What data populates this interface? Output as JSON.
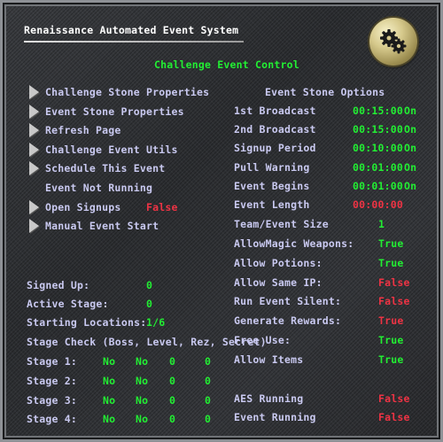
{
  "header": {
    "title": "Renaissance Automated Event System",
    "subtitle": "Challenge Event Control",
    "settings_icon": "gears-icon"
  },
  "menu": [
    {
      "label": "Challenge Stone Properties"
    },
    {
      "label": "Event Stone Properties"
    },
    {
      "label": "Refresh Page"
    },
    {
      "label": "Challenge Event Utils"
    },
    {
      "label": "Schedule This Event"
    }
  ],
  "event_status_text": "Event Not Running",
  "open_signups": {
    "label": "Open Signups",
    "value": "False"
  },
  "manual_start": {
    "label": "Manual Event Start"
  },
  "stats": {
    "signed_up": {
      "label": "Signed Up:",
      "value": "0"
    },
    "active_stage": {
      "label": "Active Stage:",
      "value": "0"
    },
    "starting_locations": {
      "label": "Starting Locations:",
      "value": "1/6"
    }
  },
  "stage_check": {
    "header": "Stage Check (Boss, Level, Rez, Secret)",
    "rows": [
      {
        "label": "Stage 1:",
        "boss": "No",
        "level": "No",
        "rez": "0",
        "secret": "0"
      },
      {
        "label": "Stage 2:",
        "boss": "No",
        "level": "No",
        "rez": "0",
        "secret": "0"
      },
      {
        "label": "Stage 3:",
        "boss": "No",
        "level": "No",
        "rez": "0",
        "secret": "0"
      },
      {
        "label": "Stage 4:",
        "boss": "No",
        "level": "No",
        "rez": "0",
        "secret": "0"
      }
    ]
  },
  "options": {
    "header": "Event Stone Options",
    "items": [
      {
        "label": "1st Broadcast",
        "value": "00:15:00",
        "extra": "On",
        "color": "#22ee33"
      },
      {
        "label": "2nd Broadcast",
        "value": "00:15:00",
        "extra": "On",
        "color": "#22ee33"
      },
      {
        "label": "Signup Period",
        "value": "00:10:00",
        "extra": "On",
        "color": "#22ee33"
      },
      {
        "label": "Pull Warning",
        "value": "00:01:00",
        "extra": "On",
        "color": "#22ee33"
      },
      {
        "label": "Event Begins",
        "value": "00:01:00",
        "extra": "On",
        "color": "#22ee33"
      },
      {
        "label": "Event Length",
        "value": "00:00:00",
        "extra": "",
        "color": "#ee3344"
      },
      {
        "label": "Team/Event Size",
        "value": "1",
        "extra": "",
        "color": "#22ee33"
      },
      {
        "label": "AllowMagic Weapons:",
        "value": "True",
        "extra": "",
        "color": "#22ee33"
      },
      {
        "label": "Allow Potions:",
        "value": "True",
        "extra": "",
        "color": "#22ee33"
      },
      {
        "label": "Allow Same IP:",
        "value": "False",
        "extra": "",
        "color": "#ee3344"
      },
      {
        "label": "Run Event Silent:",
        "value": "False",
        "extra": "",
        "color": "#ee3344"
      },
      {
        "label": "Generate Rewards:",
        "value": "True",
        "extra": "",
        "color": "#ee3344"
      },
      {
        "label": "Free Use:",
        "value": "True",
        "extra": "",
        "color": "#22ee33"
      },
      {
        "label": "Allow Items",
        "value": "True",
        "extra": "",
        "color": "#22ee33"
      }
    ]
  },
  "status": [
    {
      "label": "AES Running",
      "value": "False"
    },
    {
      "label": "Event Running",
      "value": "False"
    }
  ]
}
